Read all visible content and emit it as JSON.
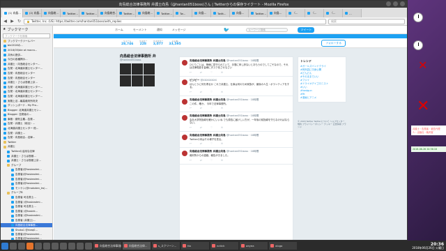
{
  "window": {
    "title": "向島総合法律事務所 弁護士向島（@hantan051boss)さん | Twitterからの保存ライクート - Mozilla Firefox"
  },
  "tabs": [
    {
      "label": "(1) 向島..."
    },
    {
      "label": "(2) 向島..."
    },
    {
      "label": "向島総..."
    },
    {
      "label": "Twitter..."
    },
    {
      "label": "Twitter..."
    },
    {
      "label": "向島総合..."
    },
    {
      "label": "Twitter..."
    },
    {
      "label": "向島総..."
    },
    {
      "label": "Twitter..."
    },
    {
      "label": "Tw..."
    },
    {
      "label": "向島..."
    },
    {
      "label": "Twitt..."
    },
    {
      "label": "向島..."
    },
    {
      "label": "Twitter..."
    },
    {
      "label": "向島..."
    },
    {
      "label": "（..."
    },
    {
      "label": "（..."
    },
    {
      "label": "（..."
    },
    {
      "label": "…"
    }
  ],
  "nav": {
    "url": "https://twitter.com/hantan051boss/with_replies",
    "site_badge": "Twitter, Inc. (US)",
    "search_placeholder": "検索",
    "back": "◀",
    "forward": "▶",
    "reload": "↻"
  },
  "sidebar": {
    "title": "ブックマーク",
    "search_placeholder": "ブックマークを検索",
    "items": [
      {
        "label": "ブックマークツールバー",
        "type": "folder",
        "indent": 0
      },
      {
        "label": "ble2016の...",
        "type": "link",
        "indent": 0
      },
      {
        "label": "2016/05/ble at macro...",
        "type": "link",
        "indent": 0
      },
      {
        "label": "共有の提供...",
        "type": "link",
        "indent": 0
      },
      {
        "label": "今日の各種掲示...",
        "type": "link",
        "indent": 0
      },
      {
        "label": "弁護士・向島総合センター...",
        "type": "link",
        "indent": 0
      },
      {
        "label": "告発・北海道弁護士センター...",
        "type": "link",
        "indent": 0
      },
      {
        "label": "告発・向島総合センター",
        "type": "link",
        "indent": 0
      },
      {
        "label": "告発・向島総合センター",
        "type": "link",
        "indent": 0
      },
      {
        "label": "弁護士・さらば首都上京...",
        "type": "link",
        "indent": 0
      },
      {
        "label": "告発・北海道弁護士センター...",
        "type": "link",
        "indent": 0
      },
      {
        "label": "告発・北海道弁護士センター...",
        "type": "link",
        "indent": 0
      },
      {
        "label": "告発・北海道弁護士センター...",
        "type": "link",
        "indent": 0
      },
      {
        "label": "実務上法...最高裁判所判決",
        "type": "link",
        "indent": 0
      },
      {
        "label": "ダッシュボード - My Pro...",
        "type": "link",
        "indent": 0
      },
      {
        "label": "Blogger: 北海道弁護士セン...",
        "type": "link",
        "indent": 0
      },
      {
        "label": "Blogger: 告発者の...",
        "type": "link",
        "indent": 0
      },
      {
        "label": "事務・原則主義...告発...",
        "type": "link",
        "indent": 0
      },
      {
        "label": "告発・弁護士（総合）...",
        "type": "link",
        "indent": 0
      },
      {
        "label": "北海道弁護士センター 他...",
        "type": "link",
        "indent": 0
      },
      {
        "label": "告発・弁護士...",
        "type": "link",
        "indent": 0
      },
      {
        "label": "告発・向島総合...法律...",
        "type": "link",
        "indent": 0
      },
      {
        "label": "Twitter",
        "type": "folder",
        "indent": 0
      },
      {
        "label": "弁護士",
        "type": "folder",
        "indent": 0
      },
      {
        "label": "Twitterの活用な法律",
        "type": "link",
        "indent": 1
      },
      {
        "label": "弁護士・さらば首都...",
        "type": "link",
        "indent": 1
      },
      {
        "label": "弁護士・さらば首都上京...",
        "type": "link",
        "indent": 1
      },
      {
        "label": "グループ",
        "type": "folder",
        "indent": 1
      },
      {
        "label": "告発者(@hosieadmi...",
        "type": "link",
        "indent": 2
      },
      {
        "label": "告発者(@hosieadmi...",
        "type": "link",
        "indent": 2
      },
      {
        "label": "告発者(@hosieadmi...",
        "type": "link",
        "indent": 2
      },
      {
        "label": "告発者(@hosieadmi...",
        "type": "link",
        "indent": 2
      },
      {
        "label": "モトケン(@motoken_tw)...",
        "type": "link",
        "indent": 2
      },
      {
        "label": "グループB",
        "type": "folder",
        "indent": 1
      },
      {
        "label": "告発者 司法書士...",
        "type": "link",
        "indent": 2
      },
      {
        "label": "告発者 (@hosieadmi...",
        "type": "link",
        "indent": 2
      },
      {
        "label": "告発者 司法書士...",
        "type": "link",
        "indent": 2
      },
      {
        "label": "告発者 (@hosiek...",
        "type": "link",
        "indent": 2
      },
      {
        "label": "告発者 (@hosieadmi...",
        "type": "link",
        "indent": 2
      },
      {
        "label": "告発者 (弁護士)...",
        "type": "link",
        "indent": 2
      },
      {
        "label": "向島総合法律事務...",
        "type": "link",
        "indent": 2,
        "selected": true
      },
      {
        "label": "Shoko1 @rbeq0...",
        "type": "link",
        "indent": 2
      },
      {
        "label": "告発者(@hosieadmi...",
        "type": "link",
        "indent": 2
      },
      {
        "label": "告発者(@hosieadmi...",
        "type": "link",
        "indent": 2
      }
    ]
  },
  "twitter": {
    "topnav": [
      "ホーム",
      "モーメント",
      "通知",
      "メッセージ"
    ],
    "search_placeholder": "キーワード検索",
    "tweet_button": "ツイート",
    "profile": {
      "name": "向島総合法律事務所 弁",
      "handle": "@hantan051boss"
    },
    "stats": [
      {
        "label": "ツイート",
        "value": "28,746"
      },
      {
        "label": "フォロー",
        "value": "228"
      },
      {
        "label": "フォロワー",
        "value": "3,077"
      },
      {
        "label": "いいね",
        "value": "33,595"
      }
    ],
    "follow_button": "フォローする",
    "tweets": [
      {
        "name": "向島総合法律事務所 弁護士向島",
        "meta": "@hantan051boss · 18時間",
        "body": "ひとりごとは、神様に見守られていて、手間に申し訳ないとおもうのでしてごそなので、それは法律相談を皆様にタスク化させなさい"
      },
      {
        "name": "ビジビー",
        "meta": "@XXXXXXXX",
        "body": "ほんとうに何を得るか\nこれで弁護士、仕事は何のため家族が、最後の人生・ボランティアをする。"
      },
      {
        "name": "向島総合法律事務所 弁護士向島",
        "meta": "@hantan051boss · 18時間",
        "body": "この件、確か。\n今年で法律事務所。"
      },
      {
        "name": "向島総合法律事務所 弁護士向島",
        "meta": "@hantan051boss · 18時間",
        "body": "会社大学院指導を確かにいいね\nでも原告に届けしい方が、一年後の前指導を守らなければならない。"
      },
      {
        "name": "向島総合法律事務所 弁護士向島",
        "meta": "@hantan051boss · 18時間",
        "body": "Twitterの本はその様子を見る。"
      },
      {
        "name": "向島総合法律事務所 弁護士向島",
        "meta": "@hantan051boss · 18時間",
        "body": "裁判所からの連絡、報告がきました。"
      }
    ],
    "trends_title": "トレンド",
    "trends": [
      {
        "tag": "#ガールズバンドクライ",
        "sub": ""
      },
      {
        "tag": "#死刑囚に中身公開",
        "sub": ""
      },
      {
        "tag": "#どんどん",
        "sub": ""
      },
      {
        "tag": "#そのままでいい",
        "sub": ""
      },
      {
        "tag": "#フジイ",
        "sub": ""
      },
      {
        "tag": "#ドライオデイゴロニスト",
        "sub": ""
      },
      {
        "tag": "#いい",
        "sub": ""
      },
      {
        "tag": "#hastgun",
        "sub": ""
      },
      {
        "tag": "#Rt",
        "sub": ""
      },
      {
        "tag": "#漫画とアニメ",
        "sub": ""
      }
    ],
    "footer": "© 2018 Twitter  Twitterについて  ヘルプセンター  規約  プライバシーポリシー  クッキー  広告情報  ブランド"
  },
  "widgets": {
    "note_red": "弁護士・告発者・被告代理人・出版社・裁判官",
    "note_green": "2018-06-26 20:36:18"
  },
  "taskbar": {
    "tasks": [
      {
        "label": "向島総合法律事務所 - Dolphin"
      },
      {
        "label": "向島総合法律..."
      },
      {
        "label": "s_スクリーン..."
      },
      {
        "label": "ttx"
      },
      {
        "label": "nctick"
      },
      {
        "label": "aeyea"
      },
      {
        "label": "xlogo"
      }
    ],
    "time": "20:36",
    "date": "2018年06月26日 火曜日"
  }
}
